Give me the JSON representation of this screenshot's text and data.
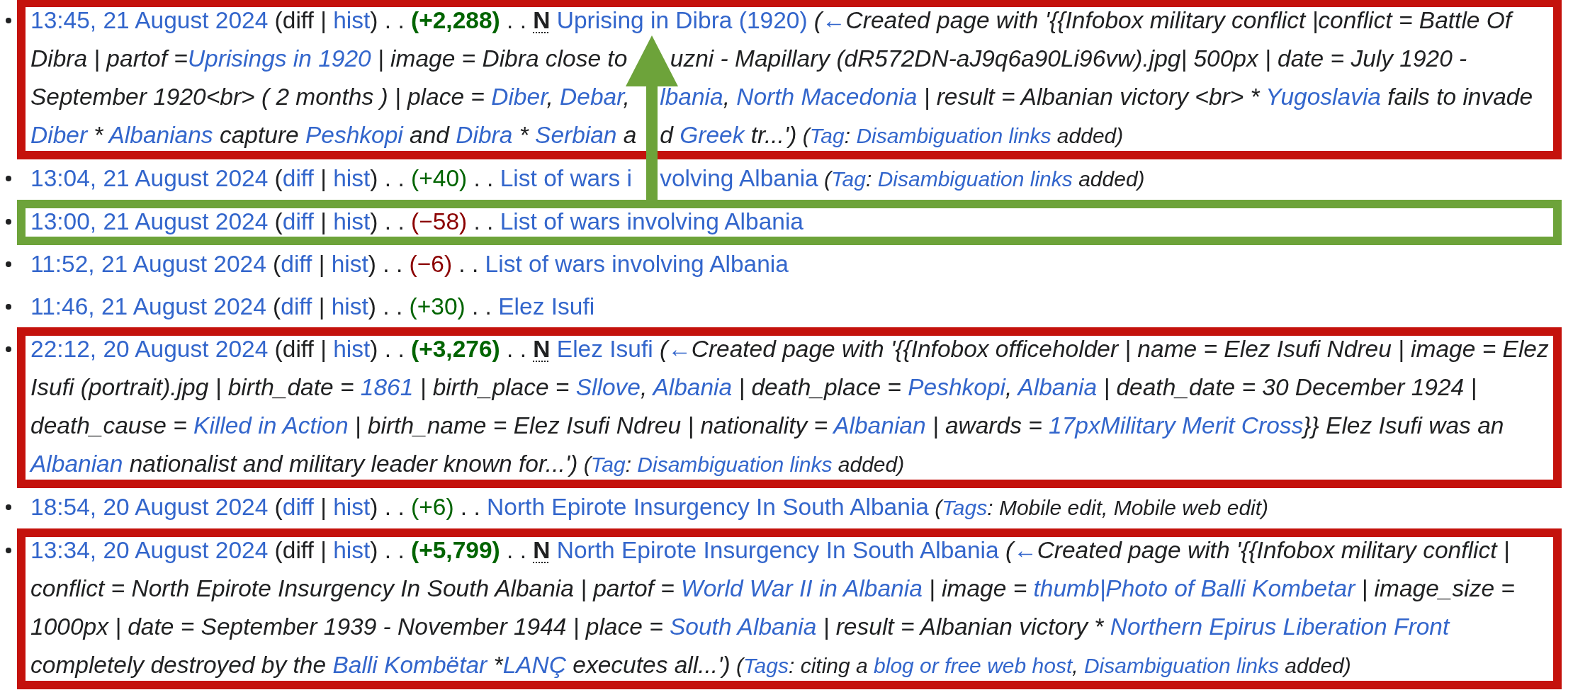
{
  "entries": [
    {
      "highlight": {
        "color": "#c4120c"
      },
      "parts": [
        {
          "kind": "timestamp",
          "text": "13:45, 21 August 2024"
        },
        {
          "kind": "text",
          "text": " (diff | "
        },
        {
          "kind": "link",
          "text": "hist"
        },
        {
          "kind": "text",
          "text": ") . . "
        },
        {
          "kind": "change",
          "text": "(+2,288)",
          "increase": true,
          "major": true
        },
        {
          "kind": "text",
          "text": " . . "
        },
        {
          "kind": "title",
          "text": "Uprising in Dibra (1920)",
          "flag": "N"
        },
        {
          "kind": "summary",
          "segments": [
            {
              "kind": "text",
              "text": " ("
            },
            {
              "kind": "link",
              "text": "←"
            },
            {
              "kind": "text",
              "text": "Created page with '{{Infobox military conflict |conflict = Battle Of Dibra | partof ="
            },
            {
              "kind": "link",
              "text": "Uprisings in 1920"
            },
            {
              "kind": "text",
              "text": " | image = Dibra close to "
            },
            {
              "kind": "gap"
            },
            {
              "kind": "text",
              "text": "uzni - Mapillary (dR572DN-aJ9q6a90Li96vw).jpg| 500px | date = July 1920 - September 1920<br> ( 2 months ) | place = "
            },
            {
              "kind": "link",
              "text": "Diber"
            },
            {
              "kind": "text",
              "text": ", "
            },
            {
              "kind": "link",
              "text": "Debar"
            },
            {
              "kind": "text",
              "text": ", "
            },
            {
              "kind": "gap"
            },
            {
              "kind": "link",
              "text": "lbania"
            },
            {
              "kind": "text",
              "text": ", "
            },
            {
              "kind": "link",
              "text": "North Macedonia"
            },
            {
              "kind": "text",
              "text": " | result = Albanian victory <br> * "
            },
            {
              "kind": "link",
              "text": "Yugoslavia"
            },
            {
              "kind": "text",
              "text": " fails to invade "
            },
            {
              "kind": "link",
              "text": "Diber"
            },
            {
              "kind": "text",
              "text": " * "
            },
            {
              "kind": "link",
              "text": "Albanians"
            },
            {
              "kind": "text",
              "text": " capture "
            },
            {
              "kind": "link",
              "text": "Peshkopi"
            },
            {
              "kind": "text",
              "text": " and "
            },
            {
              "kind": "link",
              "text": "Dibra"
            },
            {
              "kind": "text",
              "text": " * "
            },
            {
              "kind": "link",
              "text": "Serbian"
            },
            {
              "kind": "text",
              "text": " a"
            },
            {
              "kind": "gap"
            },
            {
              "kind": "text",
              "text": "d "
            },
            {
              "kind": "link",
              "text": "Greek"
            },
            {
              "kind": "text",
              "text": " tr...')"
            }
          ]
        },
        {
          "kind": "tags",
          "segments": [
            {
              "kind": "text",
              "text": " ("
            },
            {
              "kind": "link",
              "text": "Tag"
            },
            {
              "kind": "text",
              "text": ": "
            },
            {
              "kind": "link",
              "text": "Disambiguation links"
            },
            {
              "kind": "text",
              "text": " added)"
            }
          ]
        }
      ]
    },
    {
      "parts": [
        {
          "kind": "timestamp",
          "text": "13:04, 21 August 2024"
        },
        {
          "kind": "text",
          "text": " ("
        },
        {
          "kind": "link",
          "text": "diff"
        },
        {
          "kind": "text",
          "text": " | "
        },
        {
          "kind": "link",
          "text": "hist"
        },
        {
          "kind": "text",
          "text": ") . . "
        },
        {
          "kind": "change",
          "text": "(+40)",
          "increase": true,
          "major": false
        },
        {
          "kind": "text",
          "text": " . . "
        },
        {
          "kind": "title",
          "segments": [
            {
              "kind": "link",
              "text": "List of wars i"
            },
            {
              "kind": "gap"
            },
            {
              "kind": "link",
              "text": "volving Albania"
            }
          ]
        },
        {
          "kind": "tags",
          "segments": [
            {
              "kind": "text",
              "text": " ("
            },
            {
              "kind": "link",
              "text": "Tag"
            },
            {
              "kind": "text",
              "text": ": "
            },
            {
              "kind": "link",
              "text": "Disambiguation links"
            },
            {
              "kind": "text",
              "text": " added)"
            }
          ]
        }
      ]
    },
    {
      "highlight": {
        "color": "#6da33a"
      },
      "arrow": {
        "color": "#6da33a"
      },
      "parts": [
        {
          "kind": "timestamp",
          "text": "13:00, 21 August 2024"
        },
        {
          "kind": "text",
          "text": " ("
        },
        {
          "kind": "link",
          "text": "diff"
        },
        {
          "kind": "text",
          "text": " | "
        },
        {
          "kind": "link",
          "text": "hist"
        },
        {
          "kind": "text",
          "text": ") . . "
        },
        {
          "kind": "change",
          "text": "(−58)",
          "increase": false,
          "major": false
        },
        {
          "kind": "text",
          "text": " . . "
        },
        {
          "kind": "title",
          "text": "List of wars involving Albania"
        }
      ]
    },
    {
      "parts": [
        {
          "kind": "timestamp",
          "text": "11:52, 21 August 2024"
        },
        {
          "kind": "text",
          "text": " ("
        },
        {
          "kind": "link",
          "text": "diff"
        },
        {
          "kind": "text",
          "text": " | "
        },
        {
          "kind": "link",
          "text": "hist"
        },
        {
          "kind": "text",
          "text": ") . . "
        },
        {
          "kind": "change",
          "text": "(−6)",
          "increase": false,
          "major": false
        },
        {
          "kind": "text",
          "text": " . . "
        },
        {
          "kind": "title",
          "text": "List of wars involving Albania"
        }
      ]
    },
    {
      "parts": [
        {
          "kind": "timestamp",
          "text": "11:46, 21 August 2024"
        },
        {
          "kind": "text",
          "text": " ("
        },
        {
          "kind": "link",
          "text": "diff"
        },
        {
          "kind": "text",
          "text": " | "
        },
        {
          "kind": "link",
          "text": "hist"
        },
        {
          "kind": "text",
          "text": ") . . "
        },
        {
          "kind": "change",
          "text": "(+30)",
          "increase": true,
          "major": false
        },
        {
          "kind": "text",
          "text": " . . "
        },
        {
          "kind": "title",
          "text": "Elez Isufi"
        }
      ]
    },
    {
      "highlight": {
        "color": "#c4120c"
      },
      "parts": [
        {
          "kind": "timestamp",
          "text": "22:12, 20 August 2024"
        },
        {
          "kind": "text",
          "text": " (diff | "
        },
        {
          "kind": "link",
          "text": "hist"
        },
        {
          "kind": "text",
          "text": ") . . "
        },
        {
          "kind": "change",
          "text": "(+3,276)",
          "increase": true,
          "major": true
        },
        {
          "kind": "text",
          "text": " . . "
        },
        {
          "kind": "title",
          "text": "Elez Isufi",
          "flag": "N"
        },
        {
          "kind": "summary",
          "segments": [
            {
              "kind": "text",
              "text": " ("
            },
            {
              "kind": "link",
              "text": "←"
            },
            {
              "kind": "text",
              "text": "Created page with '{{Infobox officeholder | name = Elez Isufi Ndreu | image = Elez Isufi (portrait).jpg | birth_date = "
            },
            {
              "kind": "link",
              "text": "1861"
            },
            {
              "kind": "text",
              "text": " | birth_place = "
            },
            {
              "kind": "link",
              "text": "Sllove"
            },
            {
              "kind": "text",
              "text": ", "
            },
            {
              "kind": "link",
              "text": "Albania"
            },
            {
              "kind": "text",
              "text": " | death_place = "
            },
            {
              "kind": "link",
              "text": "Peshkopi"
            },
            {
              "kind": "text",
              "text": ", "
            },
            {
              "kind": "link",
              "text": "Albania"
            },
            {
              "kind": "text",
              "text": " | death_date = 30 December 1924 | death_cause = "
            },
            {
              "kind": "link",
              "text": "Killed in Action"
            },
            {
              "kind": "text",
              "text": " | birth_name = Elez Isufi Ndreu | nationality = "
            },
            {
              "kind": "link",
              "text": "Albanian"
            },
            {
              "kind": "text",
              "text": " | awards = "
            },
            {
              "kind": "link",
              "text": "17pxMilitary Merit Cross"
            },
            {
              "kind": "text",
              "text": "}} Elez Isufi was an "
            },
            {
              "kind": "link",
              "text": "Albanian"
            },
            {
              "kind": "text",
              "text": " nationalist and military leader known for...')"
            }
          ]
        },
        {
          "kind": "tags",
          "segments": [
            {
              "kind": "text",
              "text": " ("
            },
            {
              "kind": "link",
              "text": "Tag"
            },
            {
              "kind": "text",
              "text": ": "
            },
            {
              "kind": "link",
              "text": "Disambiguation links"
            },
            {
              "kind": "text",
              "text": " added)"
            }
          ]
        }
      ]
    },
    {
      "parts": [
        {
          "kind": "timestamp",
          "text": "18:54, 20 August 2024"
        },
        {
          "kind": "text",
          "text": " ("
        },
        {
          "kind": "link",
          "text": "diff"
        },
        {
          "kind": "text",
          "text": " | "
        },
        {
          "kind": "link",
          "text": "hist"
        },
        {
          "kind": "text",
          "text": ") . . "
        },
        {
          "kind": "change",
          "text": "(+6)",
          "increase": true,
          "major": false
        },
        {
          "kind": "text",
          "text": " . . "
        },
        {
          "kind": "title",
          "text": "North Epirote Insurgency In South Albania"
        },
        {
          "kind": "tags",
          "segments": [
            {
              "kind": "text",
              "text": " ("
            },
            {
              "kind": "link",
              "text": "Tags"
            },
            {
              "kind": "text",
              "text": ": Mobile edit, Mobile web edit)"
            }
          ]
        }
      ]
    },
    {
      "highlight": {
        "color": "#c4120c"
      },
      "parts": [
        {
          "kind": "timestamp",
          "text": "13:34, 20 August 2024"
        },
        {
          "kind": "text",
          "text": " (diff | "
        },
        {
          "kind": "link",
          "text": "hist"
        },
        {
          "kind": "text",
          "text": ") . . "
        },
        {
          "kind": "change",
          "text": "(+5,799)",
          "increase": true,
          "major": true
        },
        {
          "kind": "text",
          "text": " . . "
        },
        {
          "kind": "title",
          "text": "North Epirote Insurgency In South Albania",
          "flag": "N"
        },
        {
          "kind": "summary",
          "segments": [
            {
              "kind": "text",
              "text": " ("
            },
            {
              "kind": "link",
              "text": "←"
            },
            {
              "kind": "text",
              "text": "Created page with '{{Infobox military conflict | conflict = North Epirote Insurgency In South Albania | partof = "
            },
            {
              "kind": "link",
              "text": "World War II in Albania"
            },
            {
              "kind": "text",
              "text": " | image = "
            },
            {
              "kind": "link",
              "text": "thumb|Photo of Balli Kombetar"
            },
            {
              "kind": "text",
              "text": " | image_size = 1000px | date = September 1939 - November 1944 | place = "
            },
            {
              "kind": "link",
              "text": "South Albania"
            },
            {
              "kind": "text",
              "text": " | result = Albanian victory * "
            },
            {
              "kind": "link",
              "text": "Northern Epirus Liberation Front"
            },
            {
              "kind": "text",
              "text": " completely destroyed by the "
            },
            {
              "kind": "link",
              "text": "Balli Kombëtar"
            },
            {
              "kind": "text",
              "text": " *"
            },
            {
              "kind": "link",
              "text": "LANÇ"
            },
            {
              "kind": "text",
              "text": " executes all...')"
            }
          ]
        },
        {
          "kind": "tags",
          "segments": [
            {
              "kind": "text",
              "text": " ("
            },
            {
              "kind": "link",
              "text": "Tags"
            },
            {
              "kind": "text",
              "text": ": citing a "
            },
            {
              "kind": "link",
              "text": "blog or free web host"
            },
            {
              "kind": "text",
              "text": ", "
            },
            {
              "kind": "link",
              "text": "Disambiguation links"
            },
            {
              "kind": "text",
              "text": " added)"
            }
          ]
        }
      ]
    }
  ]
}
